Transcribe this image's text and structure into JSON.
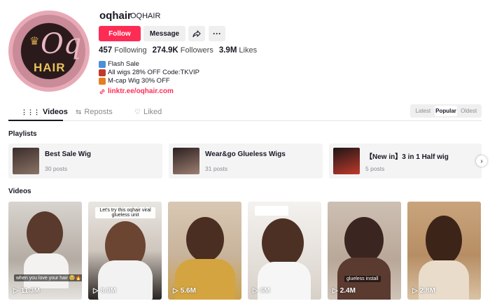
{
  "profile": {
    "username": "oqhair",
    "nickname": "OQHAIR",
    "avatar_text": "HAIR",
    "avatar_monogram": "Oq",
    "follow_label": "Follow",
    "message_label": "Message",
    "stats": [
      {
        "value": "457",
        "label": "Following"
      },
      {
        "value": "274.9K",
        "label": "Followers"
      },
      {
        "value": "3.9M",
        "label": "Likes"
      }
    ],
    "bio": [
      "Flash Sale",
      "All wigs 28% OFF Code:TKVIP",
      "M-cap Wig 30% OFF"
    ],
    "link": "linktr.ee/oqhair.com"
  },
  "tabs": [
    {
      "label": "Videos",
      "icon": "grid-icon"
    },
    {
      "label": "Reposts",
      "icon": "repost-icon"
    },
    {
      "label": "Liked",
      "icon": "heart-outline-icon"
    }
  ],
  "sort": [
    "Latest",
    "Popular",
    "Oldest"
  ],
  "playlists_title": "Playlists",
  "playlists": [
    {
      "title": "Best Sale Wig",
      "count": "30 posts"
    },
    {
      "title": "Wear&go Glueless Wigs",
      "count": "31 posts"
    },
    {
      "title": "【New in】3 in 1 Half wig",
      "count": "5 posts"
    }
  ],
  "videos_title": "Videos",
  "videos": [
    {
      "views": "11.3M",
      "caption": "when you love your hair 🥹🔥"
    },
    {
      "views": "8.9M",
      "caption": "Let's try this oqhair viral glueless unit"
    },
    {
      "views": "5.6M",
      "caption": ""
    },
    {
      "views": "6M",
      "caption": ""
    },
    {
      "views": "2.4M",
      "caption": "glueless install"
    },
    {
      "views": "2.8M",
      "caption": ""
    }
  ],
  "colors": {
    "accent": "#fe2c55",
    "text": "#161823",
    "muted": "#8a8b91"
  }
}
